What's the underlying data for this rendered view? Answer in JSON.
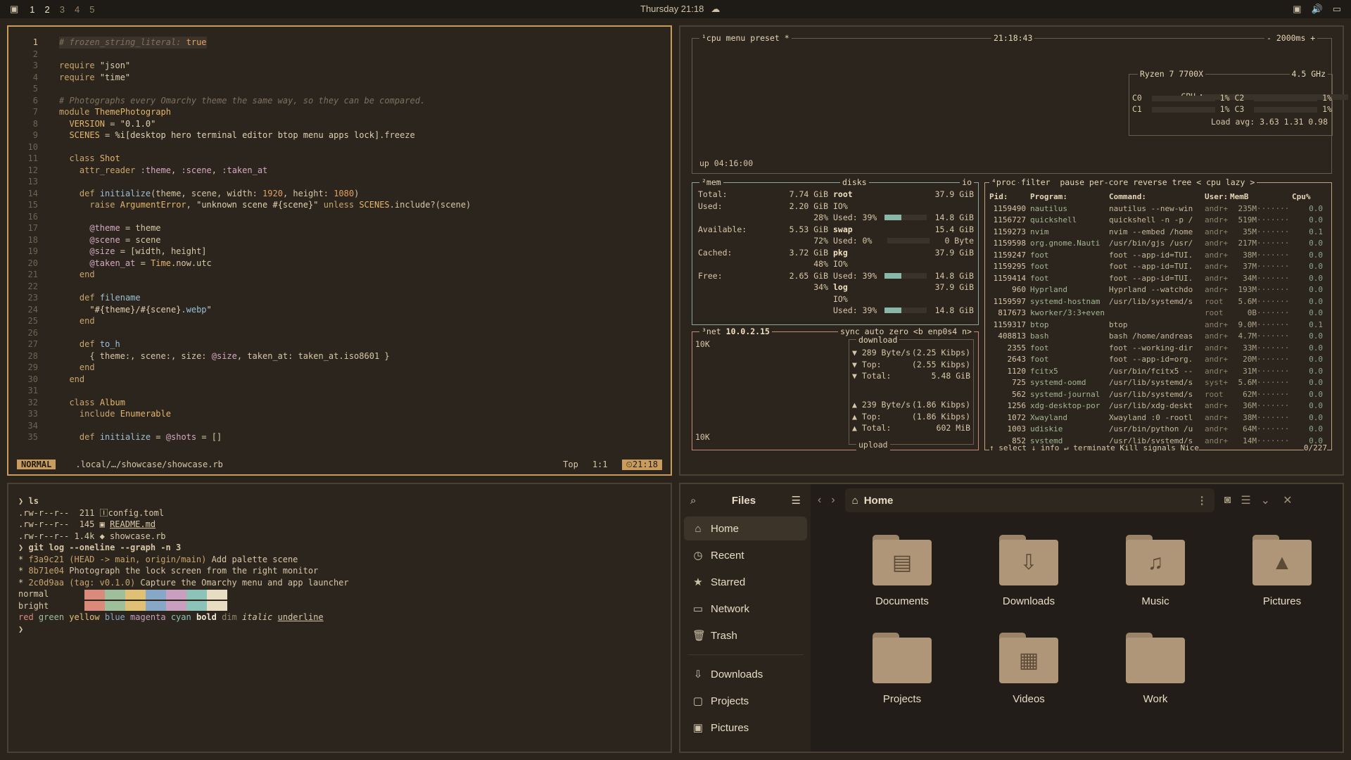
{
  "topbar": {
    "workspaces": [
      "1",
      "2",
      "3",
      "4",
      "5"
    ],
    "clock": "Thursday 21:18",
    "weather_icon": "cloud-icon",
    "tray_icons": [
      "screen-icon",
      "volume-icon",
      "monitor-icon"
    ]
  },
  "editor": {
    "lines": [
      {
        "n": "1",
        "html": "<span class=\"c-com\"># frozen_string_literal: </span><span class=\"c-num\">true</span>"
      },
      {
        "n": "2",
        "html": ""
      },
      {
        "n": "3",
        "html": "<span class=\"c-kw\">require</span> <span class=\"c-str\">\"json\"</span>"
      },
      {
        "n": "4",
        "html": "<span class=\"c-kw\">require</span> <span class=\"c-str\">\"time\"</span>"
      },
      {
        "n": "5",
        "html": ""
      },
      {
        "n": "6",
        "html": "<span class=\"c-com\"># Photographs every Omarchy theme the same way, so they can be compared.</span>"
      },
      {
        "n": "7",
        "html": "<span class=\"c-kw\">module</span> <span class=\"c-cls\">ThemePhotograph</span>"
      },
      {
        "n": "8",
        "html": "  <span class=\"c-cls\">VERSION</span> = <span class=\"c-str\">\"0.1.0\"</span>"
      },
      {
        "n": "9",
        "html": "  <span class=\"c-cls\">SCENES</span> = <span class=\"c-str\">%i[desktop hero terminal editor btop menu apps lock]</span>.freeze"
      },
      {
        "n": "10",
        "html": ""
      },
      {
        "n": "11",
        "html": "  <span class=\"c-kw\">class</span> <span class=\"c-cls\">Shot</span>"
      },
      {
        "n": "12",
        "html": "    <span class=\"c-kw\">attr_reader</span> <span class=\"c-ivar\">:theme</span>, <span class=\"c-ivar\">:scene</span>, <span class=\"c-ivar\">:taken_at</span>"
      },
      {
        "n": "13",
        "html": ""
      },
      {
        "n": "14",
        "html": "    <span class=\"c-kw\">def</span> <span class=\"c-fn\">initialize</span>(theme, scene, width: <span class=\"c-num\">1920</span>, height: <span class=\"c-num\">1080</span>)"
      },
      {
        "n": "15",
        "html": "      <span class=\"c-kw\">raise</span> <span class=\"c-cls\">ArgumentError</span>, <span class=\"c-str\">\"unknown scene #{scene}\"</span> <span class=\"c-kw\">unless</span> <span class=\"c-cls\">SCENES</span>.include?(scene)"
      },
      {
        "n": "16",
        "html": ""
      },
      {
        "n": "17",
        "html": "      <span class=\"c-ivar\">@theme</span> = theme"
      },
      {
        "n": "18",
        "html": "      <span class=\"c-ivar\">@scene</span> = scene"
      },
      {
        "n": "19",
        "html": "      <span class=\"c-ivar\">@size</span> = [width, height]"
      },
      {
        "n": "20",
        "html": "      <span class=\"c-ivar\">@taken_at</span> = <span class=\"c-cls\">Time</span>.now.utc"
      },
      {
        "n": "21",
        "html": "    <span class=\"c-kw\">end</span>"
      },
      {
        "n": "22",
        "html": ""
      },
      {
        "n": "23",
        "html": "    <span class=\"c-kw\">def</span> <span class=\"c-fn\">filename</span>"
      },
      {
        "n": "24",
        "html": "      <span class=\"c-str\">\"#{theme}/#{scene}</span><span class=\"c-fn\">.webp</span><span class=\"c-str\">\"</span>"
      },
      {
        "n": "25",
        "html": "    <span class=\"c-kw\">end</span>"
      },
      {
        "n": "26",
        "html": ""
      },
      {
        "n": "27",
        "html": "    <span class=\"c-kw\">def</span> <span class=\"c-fn\">to_h</span>"
      },
      {
        "n": "28",
        "html": "      { theme:, scene:, size: <span class=\"c-ivar\">@size</span>, taken_at: taken_at.iso8601 }"
      },
      {
        "n": "29",
        "html": "    <span class=\"c-kw\">end</span>"
      },
      {
        "n": "30",
        "html": "  <span class=\"c-kw\">end</span>"
      },
      {
        "n": "31",
        "html": ""
      },
      {
        "n": "32",
        "html": "  <span class=\"c-kw\">class</span> <span class=\"c-cls\">Album</span>"
      },
      {
        "n": "33",
        "html": "    <span class=\"c-kw\">include</span> <span class=\"c-cls\">Enumerable</span>"
      },
      {
        "n": "34",
        "html": ""
      },
      {
        "n": "35",
        "html": "    <span class=\"c-kw\">def</span> <span class=\"c-fn\">initialize</span> = <span class=\"c-ivar\">@shots</span> = []"
      }
    ],
    "mode": "NORMAL",
    "path": ".local/…/showcase/showcase.rb",
    "scroll": "Top",
    "pos": "1:1",
    "time": "21:18"
  },
  "btop": {
    "cpu_title": "¹cpu",
    "menu": "menu",
    "preset": "preset *",
    "clock": "21:18:43",
    "interval": "- 2000ms +",
    "uptime": "up 04:16:00",
    "cpu_model": "Ryzen 7 7700X",
    "cpu_freq": "4.5 GHz",
    "cpu_rows": [
      {
        "label": "CPU",
        "pct": "1%",
        "level": 0.01
      },
      {
        "label": "C0",
        "pct": "1%",
        "label2": "C2",
        "pct2": "1%"
      },
      {
        "label": "C1",
        "pct": "1%",
        "label2": "C3",
        "pct2": "1%"
      }
    ],
    "load_avg": "Load avg: 3.63 1.31 0.98",
    "mem": {
      "title": "²mem",
      "rows": [
        {
          "k": "Total:",
          "v": "7.74 GiB"
        },
        {
          "k": "Used:",
          "v": "2.20 GiB"
        },
        {
          "k": "",
          "v": "28%"
        },
        {
          "k": "Available:",
          "v": "5.53 GiB"
        },
        {
          "k": "",
          "v": "72%"
        },
        {
          "k": "Cached:",
          "v": "3.72 GiB"
        },
        {
          "k": "",
          "v": "48%"
        },
        {
          "k": "Free:",
          "v": "2.65 GiB"
        },
        {
          "k": "",
          "v": "34%"
        }
      ]
    },
    "disks": {
      "title": "disks",
      "io": "io",
      "rows": [
        {
          "name": "root",
          "size": "37.9 GiB",
          "io": "IO%",
          "used": "Used: 39%",
          "usedv": "14.8 GiB",
          "level": 0.39
        },
        {
          "name": "swap",
          "size": "15.4 GiB",
          "io": "",
          "used": "Used:  0%",
          "usedv": "0 Byte",
          "level": 0
        },
        {
          "name": "pkg",
          "size": "37.9 GiB",
          "io": "IO%",
          "used": "Used: 39%",
          "usedv": "14.8 GiB",
          "level": 0.39
        },
        {
          "name": "log",
          "size": "37.9 GiB",
          "io": "IO%",
          "used": "Used: 39%",
          "usedv": "14.8 GiB",
          "level": 0.39
        }
      ]
    },
    "net": {
      "title": "³net",
      "ip": "10.0.2.15",
      "opts": "sync auto zero <b enp0s4 n>",
      "scale_top": "10K",
      "scale_bottom": "10K",
      "download": "download",
      "upload": "upload",
      "down_rows": [
        {
          "k": "▼ 289 Byte/s",
          "v": "(2.25 Kibps)"
        },
        {
          "k": "▼ Top:",
          "v": "(2.55 Kibps)"
        },
        {
          "k": "▼ Total:",
          "v": "5.48 GiB"
        }
      ],
      "up_rows": [
        {
          "k": "▲ 239 Byte/s",
          "v": "(1.86 Kibps)"
        },
        {
          "k": "▲ Top:",
          "v": "(1.86 Kibps)"
        },
        {
          "k": "▲ Total:",
          "v": "602 MiB"
        }
      ]
    },
    "proc": {
      "title": "⁴proc",
      "opts": "filter  pause per-core reverse tree < cpu lazy >",
      "header": [
        "Pid:",
        "Program:",
        "Command:",
        "User:",
        "MemB",
        "",
        "Cpu%"
      ],
      "rows": [
        [
          "1159490",
          "nautilus",
          "nautilus --new-win",
          "andr+",
          "235M",
          "0.0"
        ],
        [
          "1156727",
          "quickshell",
          "quickshell -n -p /",
          "andr+",
          "519M",
          "0.0"
        ],
        [
          "1159273",
          "nvim",
          "nvim --embed /home",
          "andr+",
          "35M",
          "0.1"
        ],
        [
          "1159598",
          "org.gnome.Nauti",
          "/usr/bin/gjs /usr/",
          "andr+",
          "217M",
          "0.0"
        ],
        [
          "1159247",
          "foot",
          "foot --app-id=TUI.",
          "andr+",
          "38M",
          "0.0"
        ],
        [
          "1159295",
          "foot",
          "foot --app-id=TUI.",
          "andr+",
          "37M",
          "0.0"
        ],
        [
          "1159414",
          "foot",
          "foot --app-id=TUI.",
          "andr+",
          "34M",
          "0.0"
        ],
        [
          "960",
          "Hyprland",
          "Hyprland --watchdo",
          "andr+",
          "193M",
          "0.0"
        ],
        [
          "1159597",
          "systemd-hostnam",
          "/usr/lib/systemd/s",
          "root",
          "5.6M",
          "0.0"
        ],
        [
          "817673",
          "kworker/3:3+even",
          "",
          "root",
          "0B",
          "0.0"
        ],
        [
          "1159317",
          "btop",
          "btop",
          "andr+",
          "9.0M",
          "0.1"
        ],
        [
          "408813",
          "bash",
          "bash /home/andreas",
          "andr+",
          "4.7M",
          "0.0"
        ],
        [
          "2355",
          "foot",
          "foot --working-dir",
          "andr+",
          "33M",
          "0.0"
        ],
        [
          "2643",
          "foot",
          "foot --app-id=org.",
          "andr+",
          "20M",
          "0.0"
        ],
        [
          "1120",
          "fcitx5",
          "/usr/bin/fcitx5 --",
          "andr+",
          "31M",
          "0.0"
        ],
        [
          "725",
          "systemd-oomd",
          "/usr/lib/systemd/s",
          "syst+",
          "5.6M",
          "0.0"
        ],
        [
          "562",
          "systemd-journal",
          "/usr/lib/systemd/s",
          "root",
          "62M",
          "0.0"
        ],
        [
          "1256",
          "xdg-desktop-por",
          "/usr/lib/xdg-deskt",
          "andr+",
          "36M",
          "0.0"
        ],
        [
          "1072",
          "Xwayland",
          "Xwayland :0 -rootl",
          "andr+",
          "38M",
          "0.0"
        ],
        [
          "1003",
          "udiskie",
          "/usr/bin/python /u",
          "andr+",
          "64M",
          "0.0"
        ],
        [
          "852",
          "systemd",
          "/usr/lib/systemd/s",
          "andr+",
          "14M",
          "0.0"
        ]
      ],
      "footer": "↑ select ↓ info ↵ terminate Kill signals Nice",
      "count": "0/227"
    }
  },
  "terminal": {
    "lines": [
      "<span class=\"tp\">❯</span> <b>ls</b>",
      ".rw-r--r--  211 <span>🄸</span>config.toml",
      ".rw-r--r--  145 <span>▣</span> <u>README.md</u>",
      ".rw-r--r-- 1.4k <span>◆</span> showcase.rb",
      "<span class=\"tp\">❯</span> <b>git log --oneline --graph -n 3</b>",
      "* <span class=\"thash\">f3a9c21</span> <span class=\"tref\">(HEAD -&gt; main, origin/main)</span> Add palette scene",
      "* <span class=\"thash\">8b71e04</span> Photograph the lock screen from the right monitor",
      "* <span class=\"thash\">2c0d9aa</span> <span class=\"tref\">(tag: v0.1.0)</span> Capture the Omarchy menu and app launcher"
    ],
    "palette_normal_label": "normal",
    "palette_bright_label": "bright",
    "palette_colors": [
      "#2b251e",
      "#d98a7a",
      "#9fbf9a",
      "#e0c074",
      "#86a8c6",
      "#c89fbf",
      "#8cc2b8",
      "#e8dcc3"
    ],
    "styles_line": "<span style=\"color:#d98a7a\">red</span> <span style=\"color:#9fbf9a\">green</span> <span style=\"color:#e0c074\">yellow</span> <span style=\"color:#86a8c6\">blue</span> <span style=\"color:#c89fbf\">magenta</span> <span style=\"color:#8cc2b8\">cyan</span> <b style=\"color:#f3e8d2\">bold</b> <span style=\"color:#8f826c\">dim</span> <i>italic</i> <u>underline</u>",
    "prompt": "❯"
  },
  "files": {
    "app_title": "Files",
    "path": "Home",
    "sidebar": [
      {
        "label": "Home",
        "icon": "home-icon",
        "glyph": "⌂",
        "sel": true
      },
      {
        "label": "Recent",
        "icon": "recent-icon",
        "glyph": "◷"
      },
      {
        "label": "Starred",
        "icon": "star-icon",
        "glyph": "★"
      },
      {
        "label": "Network",
        "icon": "network-icon",
        "glyph": "▭"
      },
      {
        "label": "Trash",
        "icon": "trash-icon",
        "glyph": "🗑"
      }
    ],
    "bookmarks": [
      {
        "label": "Downloads",
        "icon": "download-icon",
        "glyph": "⇩"
      },
      {
        "label": "Projects",
        "icon": "folder-icon",
        "glyph": "▢"
      },
      {
        "label": "Pictures",
        "icon": "pictures-icon",
        "glyph": "▣"
      }
    ],
    "folders": [
      {
        "label": "Documents",
        "glyph": "▤"
      },
      {
        "label": "Downloads",
        "glyph": "⇩"
      },
      {
        "label": "Music",
        "glyph": "♫"
      },
      {
        "label": "Pictures",
        "glyph": "▲"
      },
      {
        "label": "Projects",
        "glyph": ""
      },
      {
        "label": "Videos",
        "glyph": "▦"
      },
      {
        "label": "Work",
        "glyph": ""
      }
    ]
  }
}
